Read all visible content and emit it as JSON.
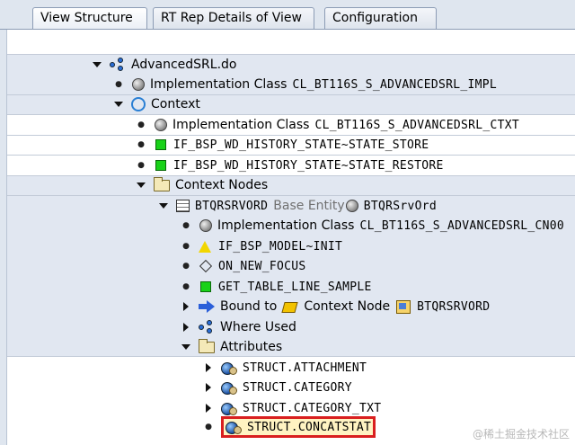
{
  "tabs": [
    {
      "label": "View Structure",
      "active": true
    },
    {
      "label": "RT Rep Details of View",
      "active": false
    },
    {
      "label": "Configuration",
      "active": false
    }
  ],
  "tree": {
    "root": {
      "label": "AdvancedSRL.do",
      "icon": "view-node-icon"
    },
    "impl1": {
      "prefix": "Implementation Class",
      "value": "CL_BT116S_S_ADVANCEDSRL_IMPL"
    },
    "context": {
      "label": "Context"
    },
    "impl2": {
      "prefix": "Implementation Class",
      "value": "CL_BT116S_S_ADVANCEDSRL_CTXT"
    },
    "method1": "IF_BSP_WD_HISTORY_STATE~STATE_STORE",
    "method2": "IF_BSP_WD_HISTORY_STATE~STATE_RESTORE",
    "context_nodes": {
      "label": "Context Nodes"
    },
    "btqr": {
      "name": "BTQRSRVORD",
      "base": "Base Entity",
      "entity": "BTQRSrvOrd"
    },
    "impl3": {
      "prefix": "Implementation Class",
      "value": "CL_BT116S_S_ADVANCEDSRL_CN00"
    },
    "method3": "IF_BSP_MODEL~INIT",
    "method4": "ON_NEW_FOCUS",
    "method5": "GET_TABLE_LINE_SAMPLE",
    "bound": {
      "prefix": "Bound to",
      "mid": "Context Node",
      "value": "BTQRSRVORD"
    },
    "where_used": "Where Used",
    "attributes": {
      "label": "Attributes"
    },
    "attr1": "STRUCT.ATTACHMENT",
    "attr2": "STRUCT.CATEGORY",
    "attr3": "STRUCT.CATEGORY_TXT",
    "attr4": "STRUCT.CONCATSTAT"
  },
  "watermark": "@稀土掘金技术社区",
  "colors": {
    "selection_border": "#d91f1f",
    "green": "#19d219",
    "blue": "#2a7fd4"
  }
}
